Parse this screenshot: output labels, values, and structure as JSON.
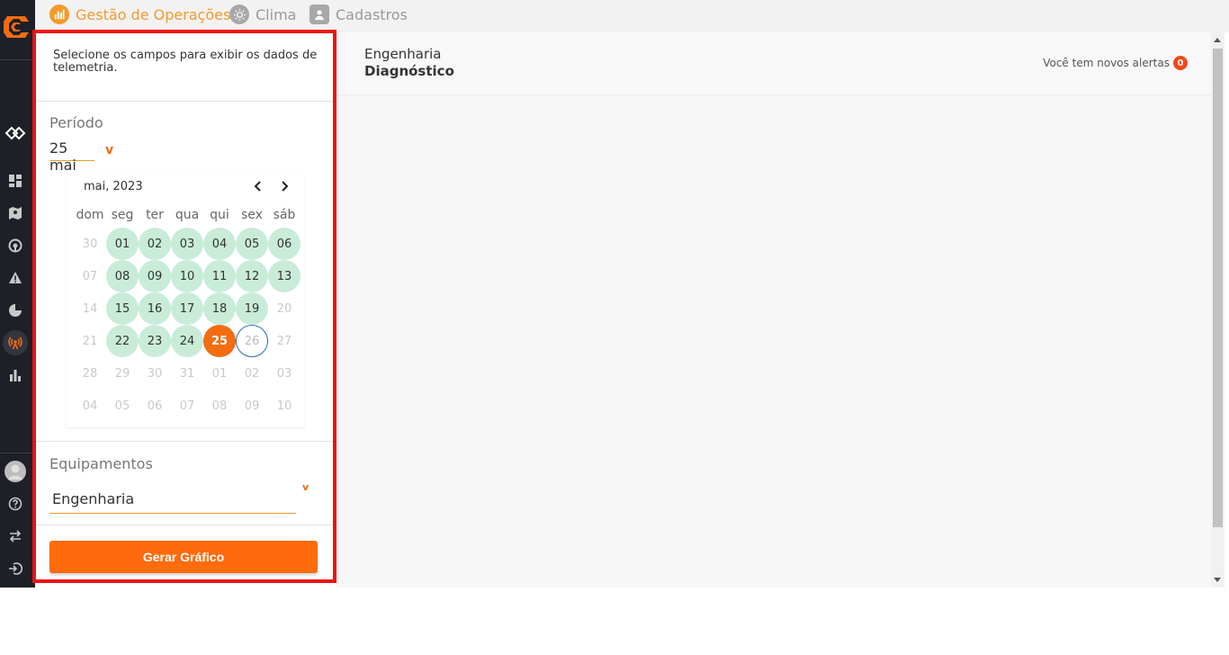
{
  "topnav": {
    "items": [
      {
        "label": "Gestão de Operações",
        "icon": "chart-bars-icon",
        "active": true
      },
      {
        "label": "Clima",
        "icon": "sun-icon",
        "active": false
      },
      {
        "label": "Cadastros",
        "icon": "user-icon",
        "active": false
      }
    ]
  },
  "panel": {
    "intro": "Selecione os campos para exibir os dados de telemetria.",
    "period_label": "Período",
    "date_value": "25 mai",
    "calendar": {
      "month_label": "mai, 2023",
      "weekdays": [
        "dom",
        "seg",
        "ter",
        "qua",
        "qui",
        "sex",
        "sáb"
      ],
      "weeks": [
        [
          {
            "d": "30",
            "s": "muted"
          },
          {
            "d": "01",
            "s": "avail"
          },
          {
            "d": "02",
            "s": "avail"
          },
          {
            "d": "03",
            "s": "avail"
          },
          {
            "d": "04",
            "s": "avail"
          },
          {
            "d": "05",
            "s": "avail"
          },
          {
            "d": "06",
            "s": "avail"
          }
        ],
        [
          {
            "d": "07",
            "s": "muted"
          },
          {
            "d": "08",
            "s": "avail"
          },
          {
            "d": "09",
            "s": "avail"
          },
          {
            "d": "10",
            "s": "avail"
          },
          {
            "d": "11",
            "s": "avail"
          },
          {
            "d": "12",
            "s": "avail"
          },
          {
            "d": "13",
            "s": "avail"
          }
        ],
        [
          {
            "d": "14",
            "s": "muted"
          },
          {
            "d": "15",
            "s": "avail"
          },
          {
            "d": "16",
            "s": "avail"
          },
          {
            "d": "17",
            "s": "avail"
          },
          {
            "d": "18",
            "s": "avail"
          },
          {
            "d": "19",
            "s": "avail"
          },
          {
            "d": "20",
            "s": "muted"
          }
        ],
        [
          {
            "d": "21",
            "s": "muted"
          },
          {
            "d": "22",
            "s": "avail"
          },
          {
            "d": "23",
            "s": "avail"
          },
          {
            "d": "24",
            "s": "avail"
          },
          {
            "d": "25",
            "s": "selected"
          },
          {
            "d": "26",
            "s": "today"
          },
          {
            "d": "27",
            "s": "muted"
          }
        ],
        [
          {
            "d": "28",
            "s": "muted"
          },
          {
            "d": "29",
            "s": "muted"
          },
          {
            "d": "30",
            "s": "muted"
          },
          {
            "d": "31",
            "s": "muted"
          },
          {
            "d": "01",
            "s": "muted"
          },
          {
            "d": "02",
            "s": "muted"
          },
          {
            "d": "03",
            "s": "muted"
          }
        ],
        [
          {
            "d": "04",
            "s": "muted"
          },
          {
            "d": "05",
            "s": "muted"
          },
          {
            "d": "06",
            "s": "muted"
          },
          {
            "d": "07",
            "s": "muted"
          },
          {
            "d": "08",
            "s": "muted"
          },
          {
            "d": "09",
            "s": "muted"
          },
          {
            "d": "10",
            "s": "muted"
          }
        ]
      ]
    },
    "equip_label": "Equipamentos",
    "equip_value": "Engenharia",
    "generate_label": "Gerar Gráfico"
  },
  "main": {
    "breadcrumb_parent": "Engenharia",
    "breadcrumb_current": "Diagnóstico",
    "alerts_text": "Você tem novos alertas",
    "alerts_count": "0"
  },
  "rail": {
    "icons": [
      "dashboard-icon",
      "map-icon",
      "speedometer-icon",
      "warning-icon",
      "pie-chart-icon",
      "telemetry-icon",
      "bar-chart-icon",
      "help-icon",
      "swap-icon",
      "logout-icon"
    ]
  },
  "colors": {
    "accent": "#f36c11",
    "available_day": "#c9ecd9",
    "highlight_border": "#ee1111"
  }
}
